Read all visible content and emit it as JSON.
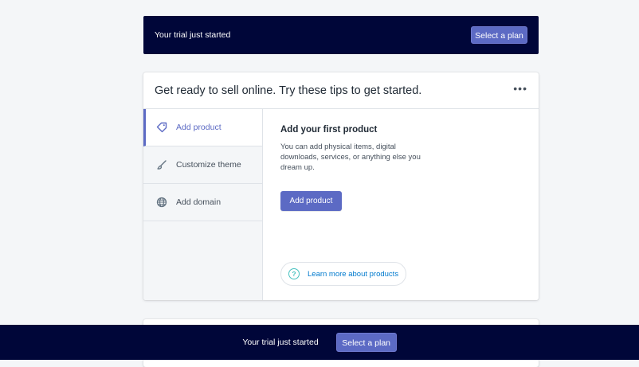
{
  "top_banner": {
    "text": "Your trial just started",
    "button_label": "Select a plan"
  },
  "card": {
    "title": "Get ready to sell online. Try these tips to get started.",
    "more_label": "•••",
    "tabs": [
      {
        "label": "Add product",
        "icon": "tag-icon",
        "active": true
      },
      {
        "label": "Customize theme",
        "icon": "brush-icon",
        "active": false
      },
      {
        "label": "Add domain",
        "icon": "globe-icon",
        "active": false
      }
    ],
    "content": {
      "title": "Add your first product",
      "description": "You can add physical items, digital downloads, services, or anything else you dream up.",
      "primary_button": "Add product",
      "learn_more": "Learn more about products",
      "illustration": "price-tag-icon"
    }
  },
  "bottom_bar": {
    "text": "Your trial just started",
    "button_label": "Select a plan"
  },
  "colors": {
    "banner": "#000639",
    "accent": "#5c6ac4",
    "tag_green": "#108043",
    "link": "#007ace"
  }
}
